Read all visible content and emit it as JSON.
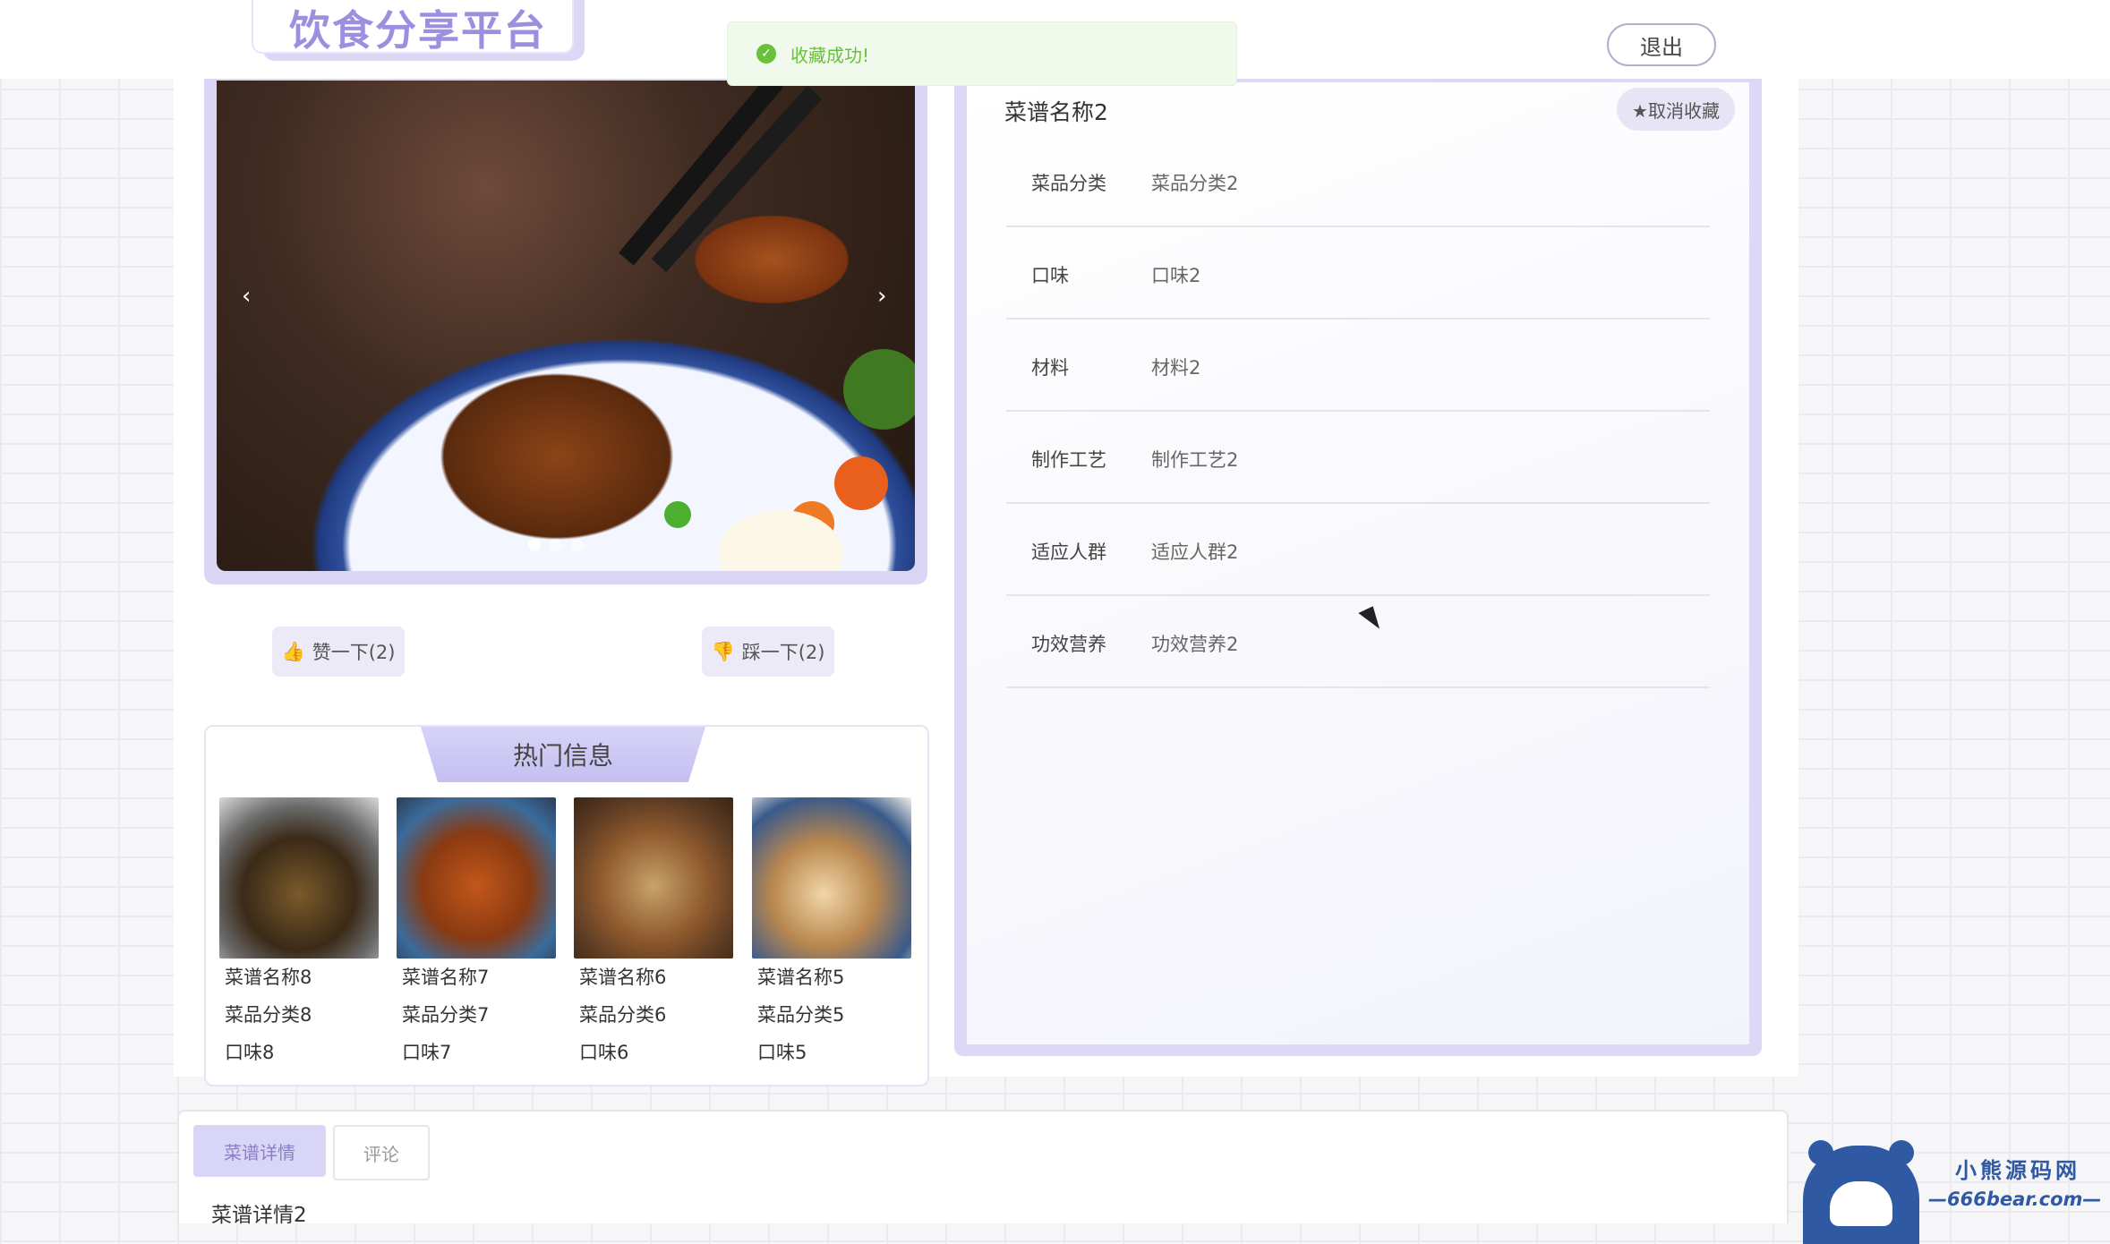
{
  "header": {
    "logo_text": "饮食分享平台",
    "logout_label": "退出"
  },
  "toast": {
    "icon": "check-circle-icon",
    "message": "收藏成功!"
  },
  "gallery": {
    "prev_label": "‹",
    "next_label": "›",
    "slide_count": 3,
    "active_slide": 1
  },
  "votes": {
    "like_label": "赞一下(2)",
    "dislike_label": "踩一下(2)"
  },
  "hot": {
    "title": "热门信息",
    "items": [
      {
        "name": "菜谱名称8",
        "category": "菜品分类8",
        "taste": "口味8"
      },
      {
        "name": "菜谱名称7",
        "category": "菜品分类7",
        "taste": "口味7"
      },
      {
        "name": "菜谱名称6",
        "category": "菜品分类6",
        "taste": "口味6"
      },
      {
        "name": "菜谱名称5",
        "category": "菜品分类5",
        "taste": "口味5"
      }
    ]
  },
  "recipe": {
    "name": "菜谱名称2",
    "unfavorite_label": "★取消收藏",
    "fields": [
      {
        "key": "菜品分类",
        "value": "菜品分类2"
      },
      {
        "key": "口味",
        "value": "口味2"
      },
      {
        "key": "材料",
        "value": "材料2"
      },
      {
        "key": "制作工艺",
        "value": "制作工艺2"
      },
      {
        "key": "适应人群",
        "value": "适应人群2"
      },
      {
        "key": "功效营养",
        "value": "功效营养2"
      }
    ]
  },
  "bottom_tabs": {
    "detail_tab": "菜谱详情",
    "comment_tab": "评论",
    "detail_text": "菜谱详情2"
  },
  "brand": {
    "name": "小熊源码网",
    "url": "—666bear.com—"
  },
  "colors": {
    "accent": "#9c8fe0",
    "accent_light": "#d9d5f6",
    "success": "#67c23a",
    "brand_blue": "#2f5aa3"
  }
}
